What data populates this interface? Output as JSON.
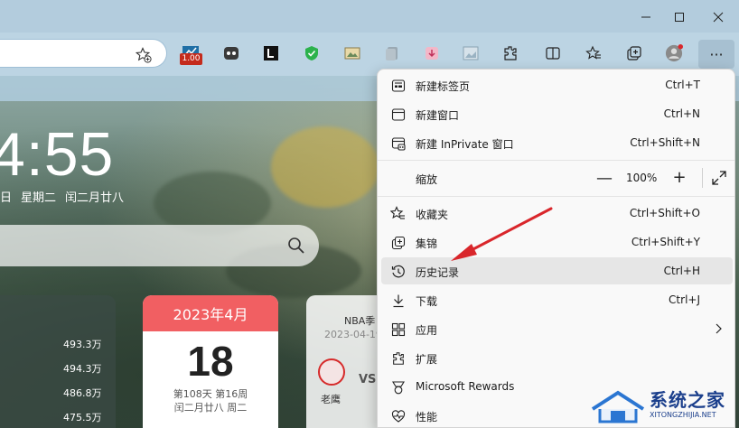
{
  "window": {
    "minimize_icon": "minimize-icon",
    "maximize_icon": "maximize-icon",
    "close_icon": "close-icon"
  },
  "toolbar": {
    "extension_badge": "1.00",
    "menu_label": "···"
  },
  "ntp": {
    "clock": "4:55",
    "date_parts": [
      "日",
      "星期二",
      "闰二月廿八"
    ],
    "stats": [
      "493.3万",
      "494.3万",
      "486.8万",
      "475.5万"
    ],
    "calendar": {
      "month": "2023年4月",
      "day": "18",
      "line1": "第108天 第16周",
      "line2": "闰二月廿八 周二"
    },
    "nba": {
      "title": "NBA季",
      "date": "2023-04-19",
      "team": "老鹰",
      "vs": "VS"
    }
  },
  "menu": {
    "items": [
      {
        "label": "新建标签页",
        "shortcut": "Ctrl+T",
        "icon": "new-tab-icon"
      },
      {
        "label": "新建窗口",
        "shortcut": "Ctrl+N",
        "icon": "new-window-icon"
      },
      {
        "label": "新建 InPrivate 窗口",
        "shortcut": "Ctrl+Shift+N",
        "icon": "inprivate-icon"
      },
      {
        "label": "缩放",
        "value": "100%",
        "minus": "—",
        "plus": "+"
      },
      {
        "label": "收藏夹",
        "shortcut": "Ctrl+Shift+O",
        "icon": "favorites-icon"
      },
      {
        "label": "集锦",
        "shortcut": "Ctrl+Shift+Y",
        "icon": "collections-icon"
      },
      {
        "label": "历史记录",
        "shortcut": "Ctrl+H",
        "icon": "history-icon"
      },
      {
        "label": "下载",
        "shortcut": "Ctrl+J",
        "icon": "download-icon"
      },
      {
        "label": "应用",
        "shortcut": "",
        "icon": "apps-icon"
      },
      {
        "label": "扩展",
        "shortcut": "",
        "icon": "extensions-icon"
      },
      {
        "label": "Microsoft Rewards",
        "shortcut": "",
        "icon": "rewards-icon"
      },
      {
        "label": "性能",
        "shortcut": "",
        "icon": "performance-icon"
      }
    ]
  },
  "watermark": {
    "title": "系统之家",
    "url": "XITONGZHIJIA.NET"
  },
  "colors": {
    "accent_red": "#d9262b",
    "menu_bg": "#f9f9f9",
    "highlight": "#e6e6e6",
    "calendar_head": "#f15f62"
  }
}
